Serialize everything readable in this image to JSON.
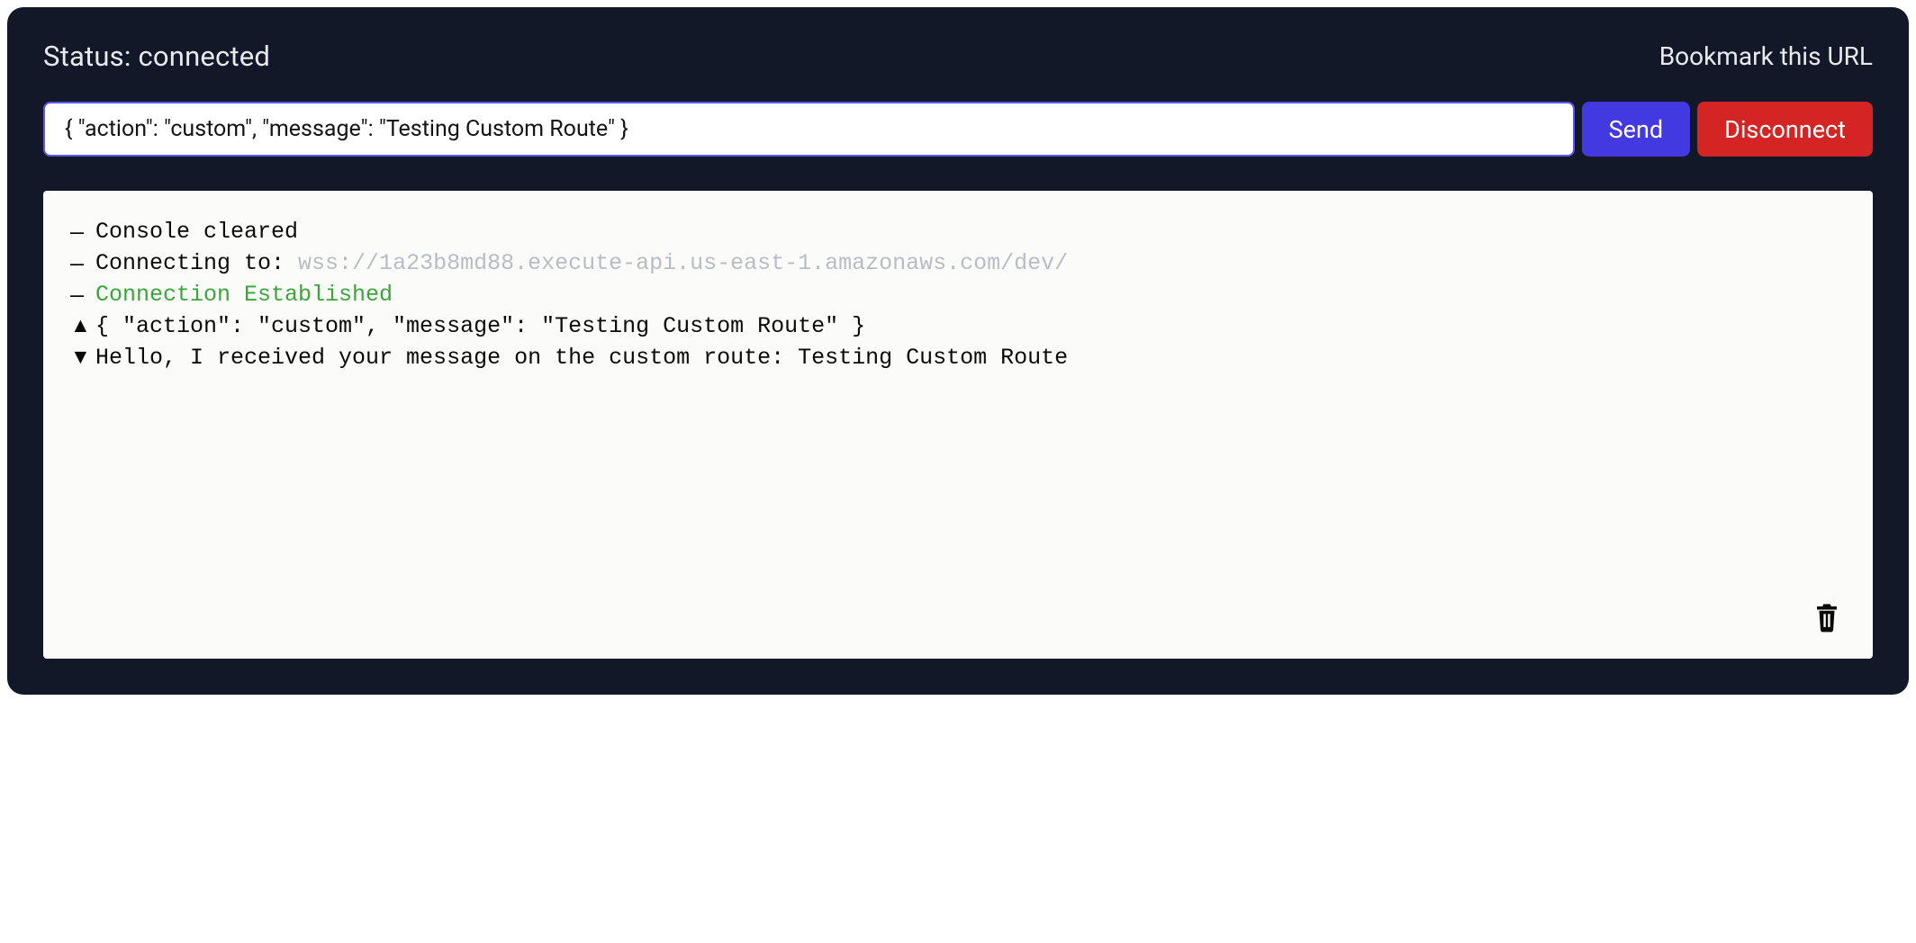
{
  "header": {
    "status_label": "Status: connected",
    "bookmark_label": "Bookmark this URL"
  },
  "input": {
    "value": "{ \"action\": \"custom\", \"message\": \"Testing Custom Route\" }"
  },
  "buttons": {
    "send": "Send",
    "disconnect": "Disconnect"
  },
  "console": {
    "lines": [
      {
        "marker": "–",
        "marker_kind": "dash",
        "text": "Console cleared",
        "color": "default"
      },
      {
        "marker": "–",
        "marker_kind": "dash",
        "text": "Connecting to: ",
        "suffix": "wss://1a23b8md88.execute-api.us-east-1.amazonaws.com/dev/",
        "suffix_color": "url",
        "color": "default"
      },
      {
        "marker": "–",
        "marker_kind": "dash",
        "text": "Connection Established",
        "color": "green"
      },
      {
        "marker": "▲",
        "marker_kind": "arrow",
        "text": "{ \"action\": \"custom\", \"message\": \"Testing Custom Route\" }",
        "color": "default"
      },
      {
        "marker": "▼",
        "marker_kind": "arrow",
        "text": "Hello, I received your message on the custom route: Testing Custom Route",
        "color": "default"
      }
    ]
  }
}
